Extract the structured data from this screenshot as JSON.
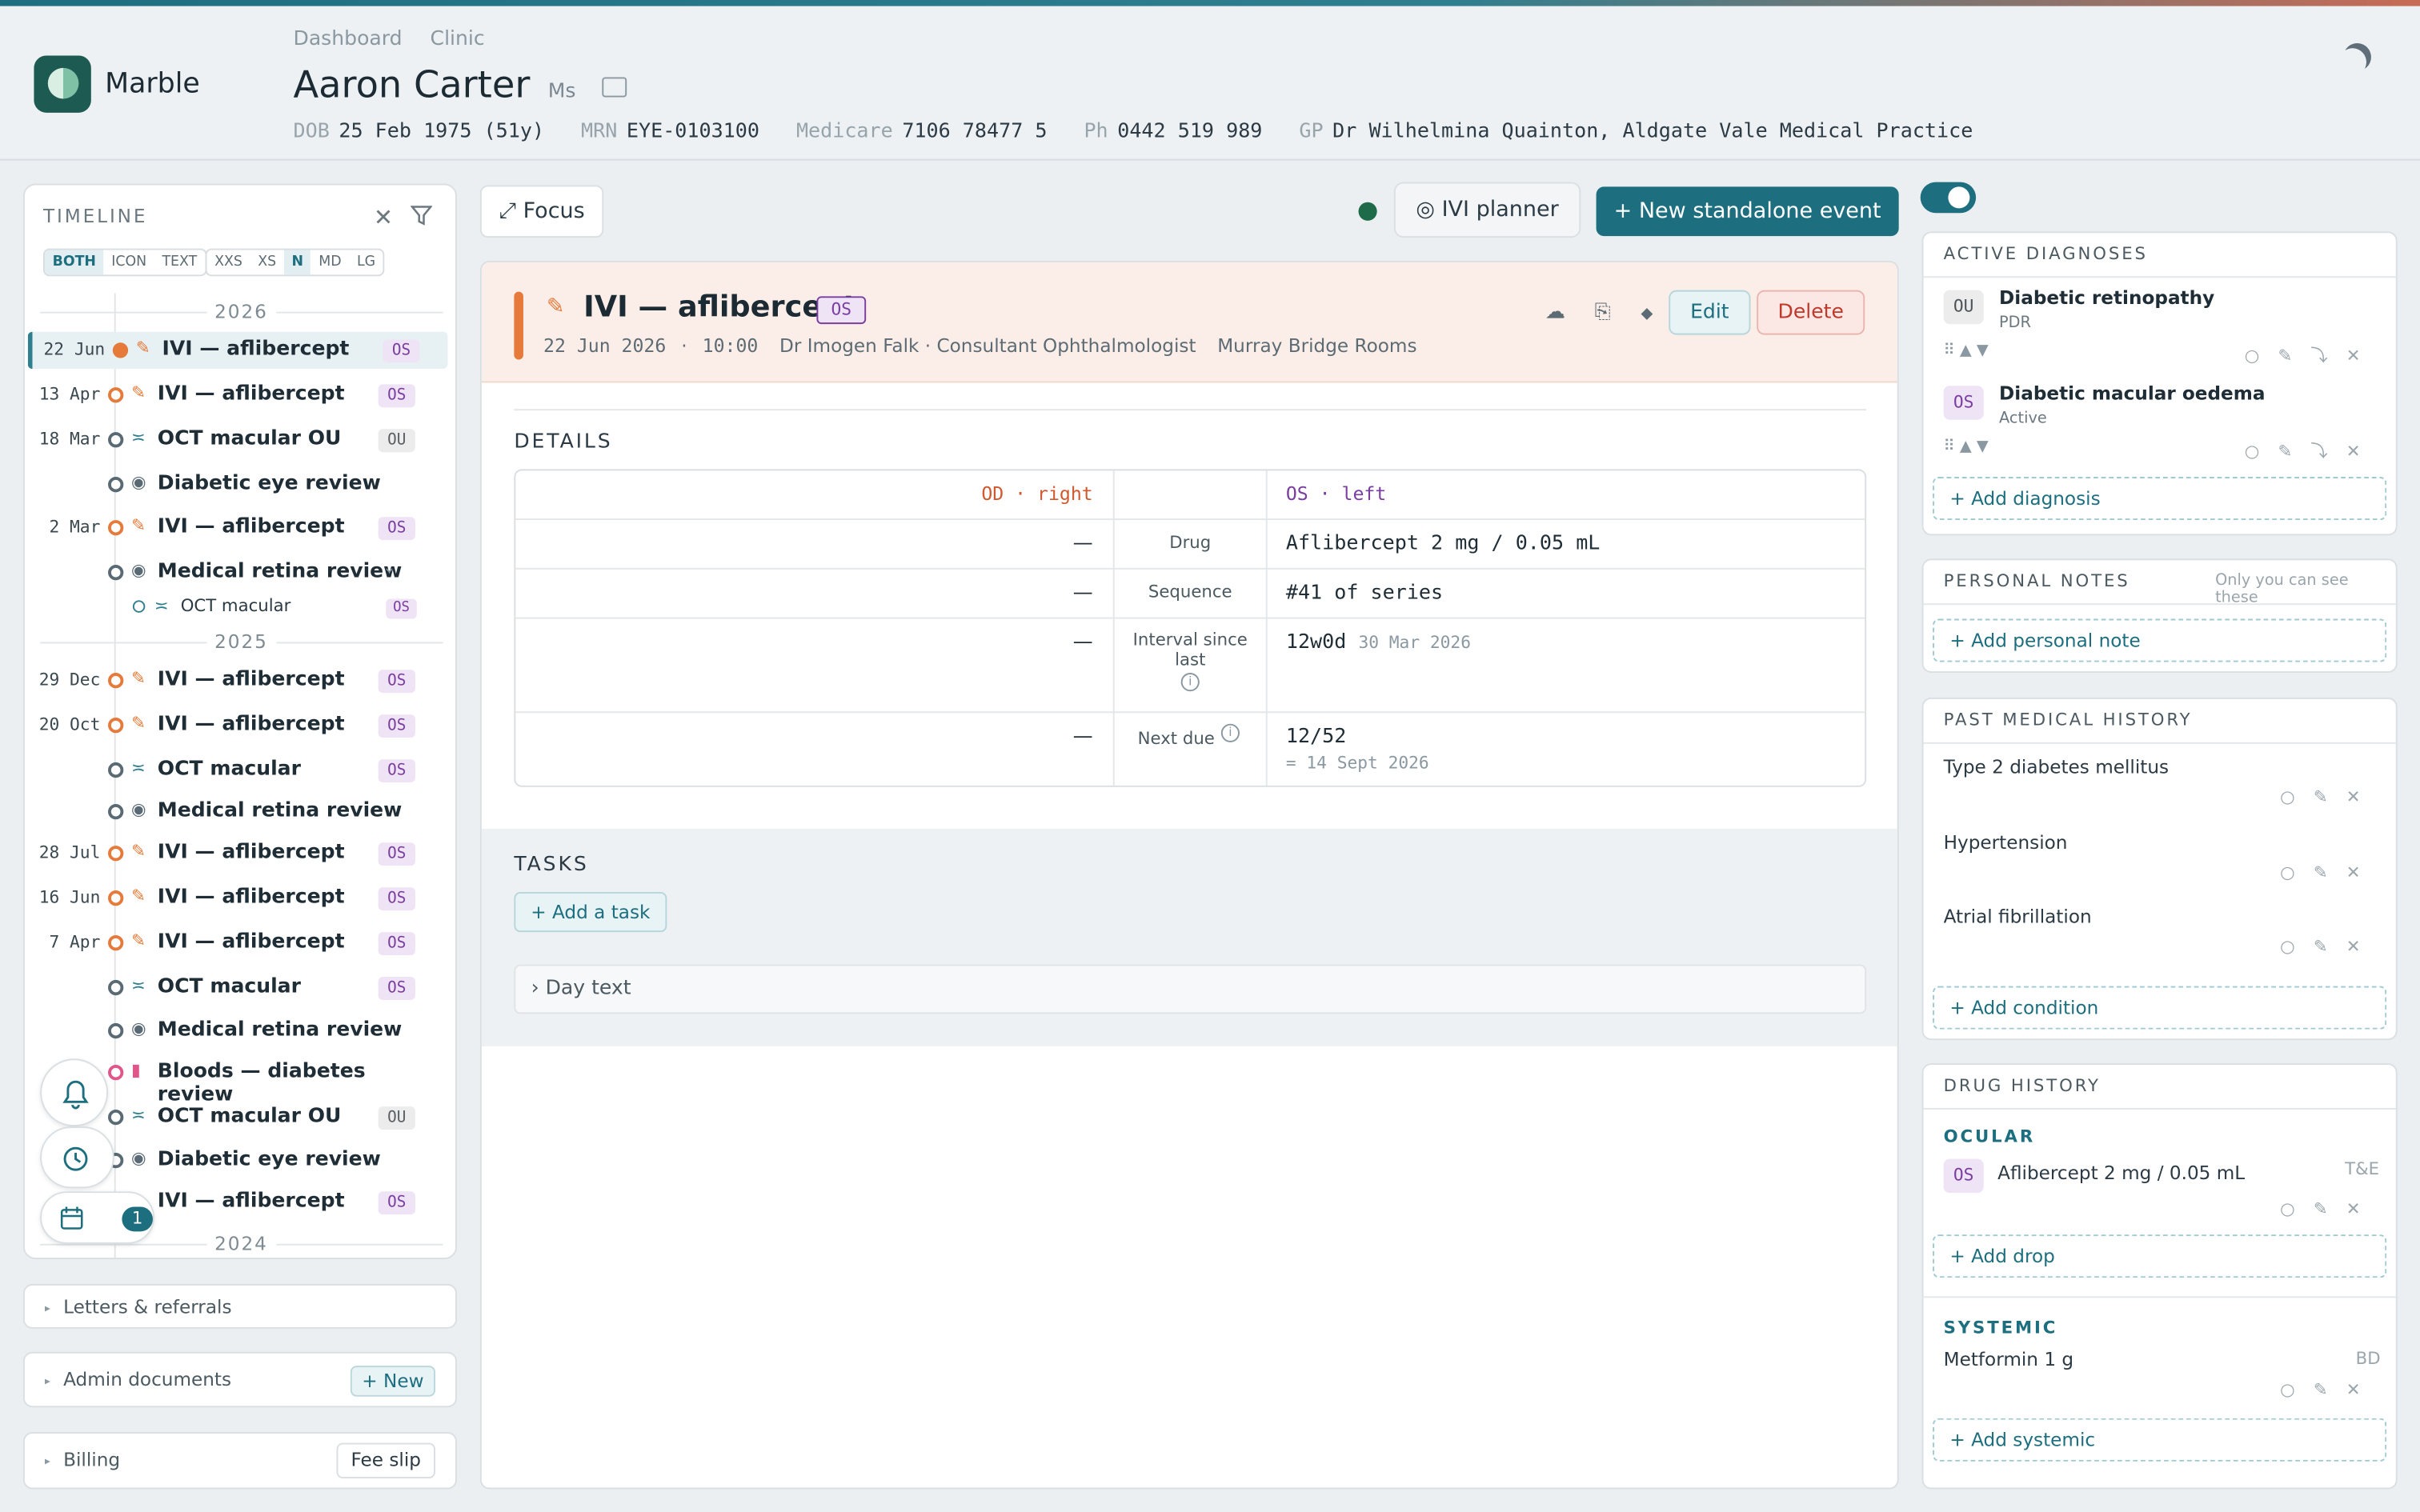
{
  "header": {
    "app_name": "Marble",
    "breadcrumbs": [
      "Dashboard",
      "Clinic"
    ],
    "patient_name": "Aaron Carter",
    "patient_title": "Ms",
    "dob_label": "DOB",
    "dob_value": "25 Feb 1975 (51y)",
    "mrn_label": "MRN",
    "mrn_value": "EYE-0103100",
    "medicare_label": "Medicare",
    "medicare_value": "7106 78477 5",
    "ph_label": "Ph",
    "ph_value": "0442 519 989",
    "gp_label": "GP",
    "gp_value": "Dr Wilhelmina Quainton, Aldgate Vale Medical Practice"
  },
  "timeline": {
    "title": "TIMELINE",
    "seg1": [
      "BOTH",
      "ICON",
      "TEXT"
    ],
    "seg2": [
      "XXS",
      "XS",
      "N",
      "MD",
      "LG"
    ],
    "years": [
      "2026",
      "2025",
      "2024"
    ],
    "events": [
      {
        "date": "22 Jun",
        "label": "IVI — aflibercept",
        "tag": "OS"
      },
      {
        "date": "13 Apr",
        "label": "IVI — aflibercept",
        "tag": "OS"
      },
      {
        "date": "18 Mar",
        "label": "OCT macular OU",
        "tag": "OU"
      },
      {
        "date": "",
        "label": "Diabetic eye review",
        "tag": ""
      },
      {
        "date": "2 Mar",
        "label": "IVI — aflibercept",
        "tag": "OS"
      },
      {
        "date": "",
        "label": "Medical retina review",
        "tag": ""
      },
      {
        "date": "29 Dec",
        "label": "IVI — aflibercept",
        "tag": "OS"
      },
      {
        "date": "20 Oct",
        "label": "IVI — aflibercept",
        "tag": "OS"
      },
      {
        "date": "",
        "label": "OCT macular",
        "tag": "OS"
      },
      {
        "date": "",
        "label": "Medical retina review",
        "tag": ""
      },
      {
        "date": "28 Jul",
        "label": "IVI — aflibercept",
        "tag": "OS"
      },
      {
        "date": "16 Jun",
        "label": "IVI — aflibercept",
        "tag": "OS"
      },
      {
        "date": "7 Apr",
        "label": "IVI — aflibercept",
        "tag": "OS"
      },
      {
        "date": "",
        "label": "OCT macular",
        "tag": "OS"
      },
      {
        "date": "",
        "label": "Medical retina review",
        "tag": ""
      },
      {
        "date": "",
        "label": "Bloods — diabetes review",
        "tag": ""
      },
      {
        "date": "",
        "label": "OCT macular OU",
        "tag": "OU"
      },
      {
        "date": "",
        "label": "Diabetic eye review",
        "tag": ""
      },
      {
        "date": "",
        "label": "IVI — aflibercept",
        "tag": "OS"
      }
    ],
    "sub_event": {
      "label": "OCT macular",
      "tag": "OS"
    },
    "calendar_count": "1"
  },
  "left_panels": {
    "letters": "Letters & referrals",
    "admin": "Admin documents",
    "admin_new": "+ New",
    "billing": "Billing",
    "fee_slip": "Fee slip"
  },
  "toolbar": {
    "focus": "Focus",
    "ivi_planner": "IVI planner",
    "new_event": "New standalone event"
  },
  "event": {
    "title": "IVI — aflibercept",
    "tag": "OS",
    "date": "22 Jun 2026",
    "time": "10:00",
    "clinician": "Dr Imogen Falk · Consultant Ophthalmologist",
    "location": "Murray Bridge Rooms",
    "edit": "Edit",
    "delete": "Delete"
  },
  "details": {
    "title": "DETAILS",
    "od_header": "OD · right",
    "os_header": "OS · left",
    "rows": [
      {
        "label": "Drug",
        "od": "—",
        "os": "Aflibercept 2 mg / 0.05 mL",
        "os_sub": ""
      },
      {
        "label": "Sequence",
        "od": "—",
        "os": "#41 of series",
        "os_sub": ""
      },
      {
        "label": "Interval since last",
        "od": "—",
        "os": "12w0d",
        "os_sub": "30 Mar 2026"
      },
      {
        "label": "Next due",
        "od": "—",
        "os": "12/52",
        "os_sub": "= 14 Sept 2026"
      }
    ]
  },
  "tasks": {
    "title": "TASKS",
    "add": "+ Add a task",
    "day_text": "Day text"
  },
  "active_diagnoses": {
    "title": "ACTIVE DIAGNOSES",
    "items": [
      {
        "eye": "OU",
        "name": "Diabetic retinopathy",
        "status": "PDR"
      },
      {
        "eye": "OS",
        "name": "Diabetic macular oedema",
        "status": "Active"
      }
    ],
    "add": "+ Add diagnosis"
  },
  "personal_notes": {
    "title": "PERSONAL NOTES",
    "hint": "Only you can see these",
    "add": "+ Add personal note"
  },
  "pmh": {
    "title": "PAST MEDICAL HISTORY",
    "items": [
      "Type 2 diabetes mellitus",
      "Hypertension",
      "Atrial fibrillation"
    ],
    "add": "+ Add condition"
  },
  "drug_history": {
    "title": "DRUG HISTORY",
    "ocular_label": "OCULAR",
    "ocular": {
      "eye": "OS",
      "name": "Aflibercept 2 mg / 0.05 mL",
      "freq": "T&E"
    },
    "add_drop": "+ Add drop",
    "systemic_label": "SYSTEMIC",
    "systemic": {
      "name": "Metformin 1 g",
      "freq": "BD"
    },
    "add_systemic": "+ Add systemic"
  },
  "colors": {
    "accent": "#1d6f80",
    "ivi": "#e57a3a",
    "os": "#7a3ea1",
    "danger": "#c0392b"
  }
}
